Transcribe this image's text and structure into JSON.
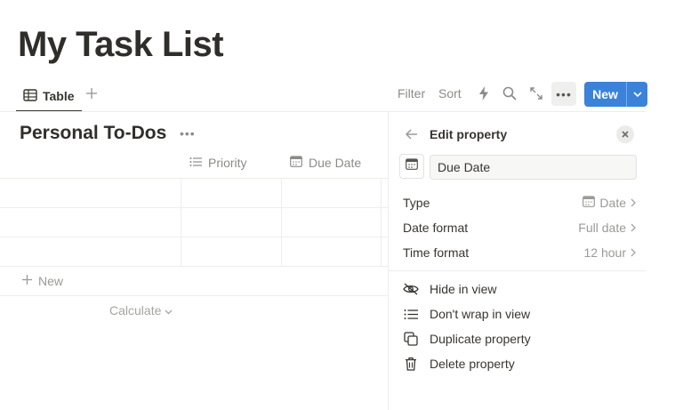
{
  "page": {
    "title": "My Task List"
  },
  "views": {
    "tabs": [
      {
        "label": "Table",
        "icon": "table-icon"
      }
    ],
    "add_icon": "plus-icon"
  },
  "toolbar": {
    "filter_label": "Filter",
    "sort_label": "Sort",
    "new_label": "New",
    "icons": [
      "lightning-icon",
      "search-icon",
      "expand-icon",
      "more-icon",
      "chevron-down-icon"
    ]
  },
  "database": {
    "title": "Personal To-Dos",
    "columns": [
      {
        "label": "Priority",
        "icon": "list-icon"
      },
      {
        "label": "Due Date",
        "icon": "calendar-icon"
      }
    ],
    "row_count": 3,
    "new_row_label": "New",
    "calculate_label": "Calculate"
  },
  "property_panel": {
    "title": "Edit property",
    "name_value": "Due Date",
    "settings": [
      {
        "label": "Type",
        "value": "Date",
        "icon": "calendar-icon"
      },
      {
        "label": "Date format",
        "value": "Full date"
      },
      {
        "label": "Time format",
        "value": "12 hour"
      }
    ],
    "actions": [
      {
        "label": "Hide in view",
        "icon": "eye-off-icon"
      },
      {
        "label": "Don't wrap in view",
        "icon": "list-icon"
      },
      {
        "label": "Duplicate property",
        "icon": "duplicate-icon"
      },
      {
        "label": "Delete property",
        "icon": "trash-icon"
      }
    ]
  },
  "colors": {
    "accent": "#3b82d9",
    "text": "#37352f",
    "muted": "#8c8b87",
    "border": "#ededec"
  }
}
